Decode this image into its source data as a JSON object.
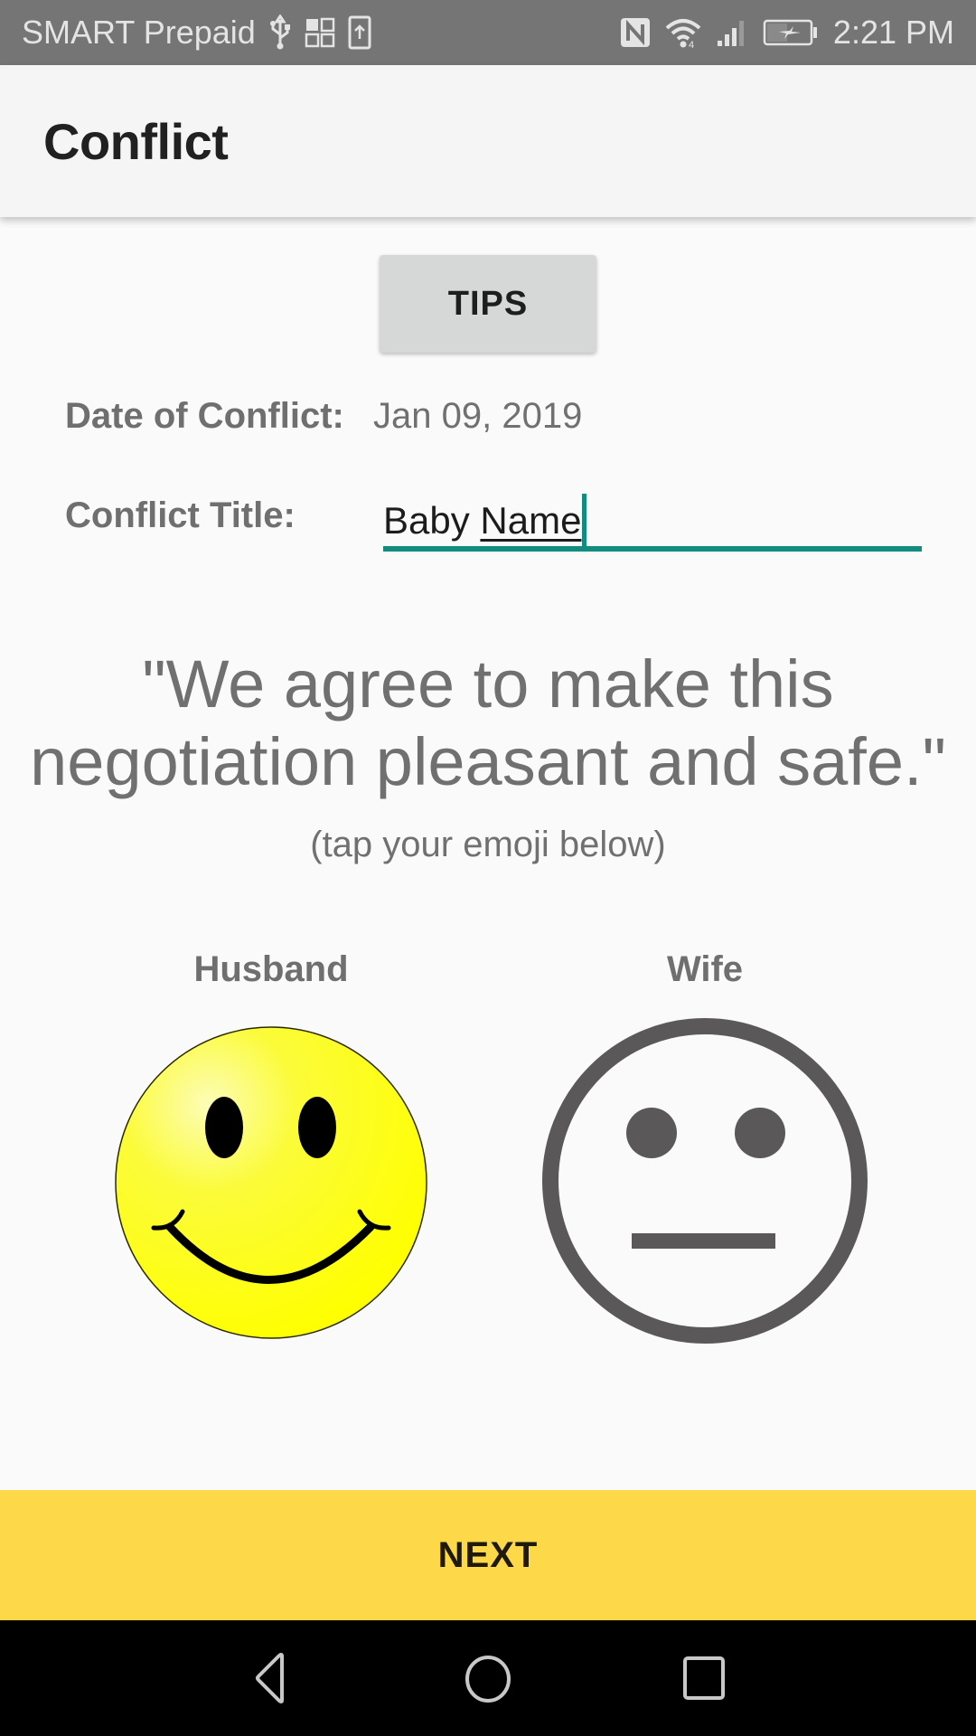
{
  "status_bar": {
    "carrier": "SMART Prepaid",
    "left_icons": [
      "usb-icon",
      "apps-grid-icon",
      "upload-icon"
    ],
    "right_icons": [
      "nfc-icon",
      "wifi-icon",
      "signal-icon",
      "battery-charging-icon"
    ],
    "time": "2:21 PM"
  },
  "app_bar": {
    "title": "Conflict"
  },
  "tips_button": {
    "label": "TIPS"
  },
  "form": {
    "date_label": "Date of Conflict:",
    "date_value": "Jan 09, 2019",
    "title_label": "Conflict Title:",
    "title_value_prefix": "Baby ",
    "title_value_composing": "Name",
    "title_value": "Baby Name"
  },
  "pledge": {
    "line1": "\"We agree to make this",
    "line2": "negotiation pleasant and safe.\"",
    "hint": "(tap your emoji below)"
  },
  "participants": [
    {
      "label": "Husband",
      "emoji": "happy-face",
      "state": "agreed"
    },
    {
      "label": "Wife",
      "emoji": "neutral-face",
      "state": "not-agreed"
    }
  ],
  "colors": {
    "accent": "#128c7e",
    "next_button": "#fdd94a",
    "happy_face": "#ffff00",
    "neutral_face": "#5a5859"
  },
  "next_button": {
    "label": "NEXT"
  },
  "nav_bar": {
    "buttons": [
      "back-icon",
      "home-icon",
      "recents-icon"
    ]
  }
}
